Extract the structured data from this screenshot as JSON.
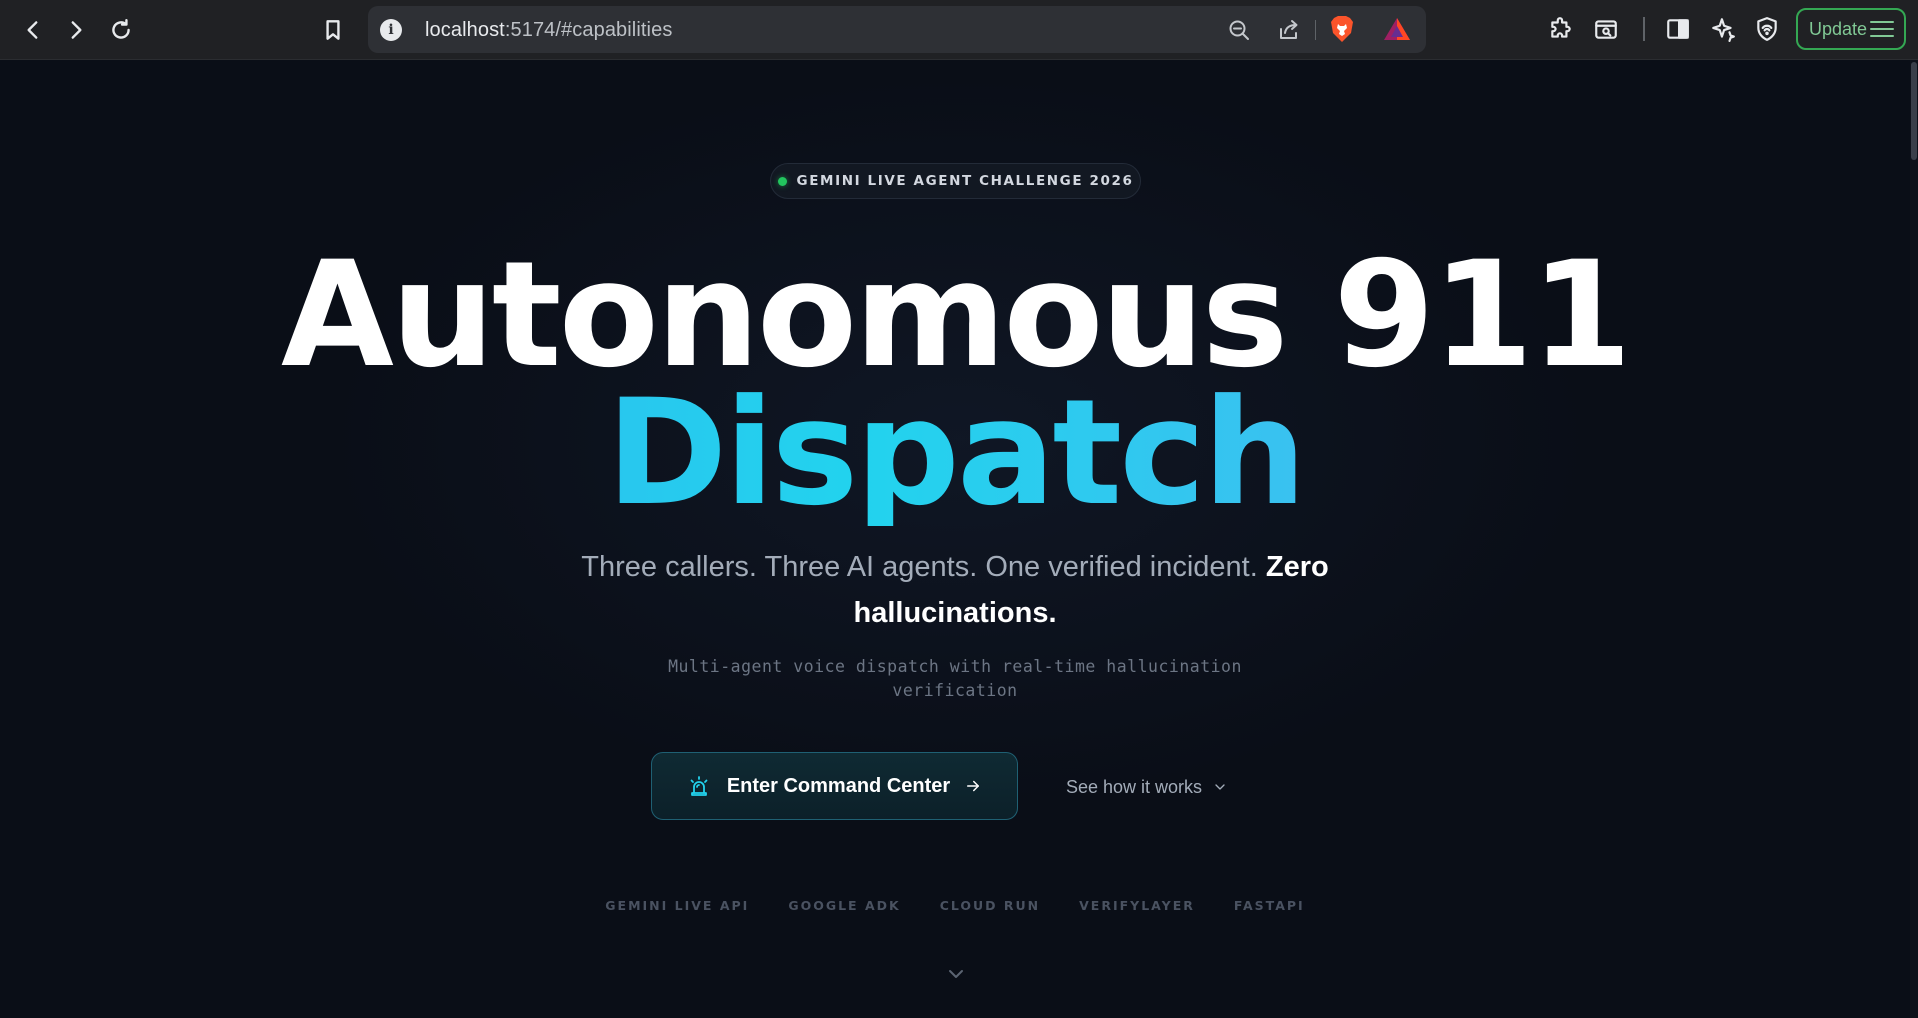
{
  "browser": {
    "url_host": "localhost",
    "url_rest": ":5174/#capabilities",
    "update_label": "Update",
    "accent": "#34a853",
    "icons": [
      "back-icon",
      "forward-icon",
      "reload-icon",
      "bookmark-icon",
      "site-info-icon",
      "zoom-out-icon",
      "share-icon",
      "brave-shields-icon",
      "brave-rewards-icon",
      "extensions-icon",
      "tab-search-icon",
      "sidebar-icon",
      "leo-ai-icon",
      "vpn-icon",
      "menu-icon"
    ]
  },
  "hero": {
    "badge": "GEMINI LIVE AGENT CHALLENGE 2026",
    "badge_dot_color": "#22c55e",
    "title_line1": "Autonomous 911",
    "title_line2": "Dispatch",
    "tagline_main": "Three callers. Three AI agents. One verified incident.",
    "tagline_strong": "Zero hallucinations.",
    "subline": "Multi-agent voice dispatch with real-time hallucination verification",
    "primary_cta": "Enter Command Center",
    "secondary_cta": "See how it works",
    "accent_gradient": [
      "#38a9ee",
      "#22d3ee",
      "#5aa8f2"
    ]
  },
  "tech_stack": [
    "GEMINI LIVE API",
    "GOOGLE ADK",
    "CLOUD RUN",
    "VERIFYLAYER",
    "FASTAPI"
  ]
}
